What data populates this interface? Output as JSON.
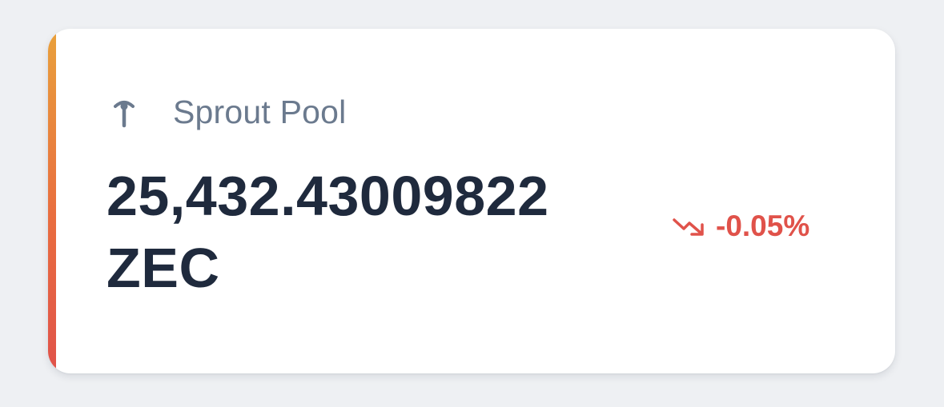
{
  "pool": {
    "name": "Sprout Pool",
    "icon": "sprout-icon",
    "amount_value": "25,432.43009822",
    "amount_unit": "ZEC",
    "change_text": "-0.05%",
    "change_icon": "trending-down-icon",
    "change_color": "#e0524a"
  },
  "colors": {
    "accent_top": "#e9a13b",
    "accent_bottom": "#e0524a",
    "text_primary": "#1f2a3d",
    "text_secondary": "#6b7a8e",
    "background": "#eef0f3",
    "card": "#ffffff"
  }
}
